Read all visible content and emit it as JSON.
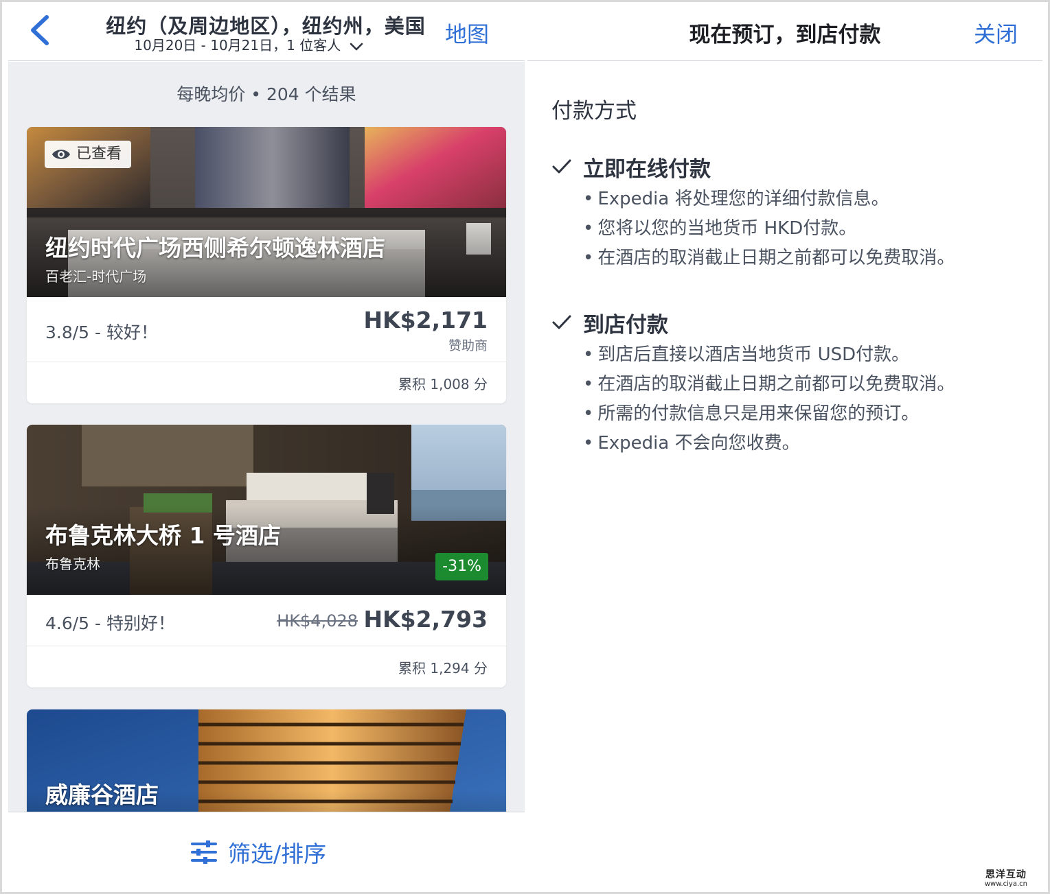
{
  "left": {
    "header": {
      "title": "纽约（及周边地区），纽约州，美国",
      "subtitle": "10月20日 - 10月21日，1 位客人",
      "map_label": "地图"
    },
    "summary": "每晚均价 • 204 个结果",
    "hotels": [
      {
        "name": "纽约时代广场西侧希尔顿逸林酒店",
        "area": "百老汇-时代广场",
        "viewed_label": "已查看",
        "rating": "3.8/5 - 较好！",
        "price": "HK$2,171",
        "sponsor": "赞助商",
        "points": "累积 1,008 分"
      },
      {
        "name": "布鲁克林大桥 1 号酒店",
        "area": "布鲁克林",
        "discount": "-31%",
        "rating": "4.6/5 - 特别好！",
        "old_price": "HK$4,028",
        "price": "HK$2,793",
        "points": "累积 1,294 分"
      },
      {
        "name": "威廉谷酒店"
      }
    ],
    "filter_label": "筛选/排序"
  },
  "right": {
    "title": "现在预订，到店付款",
    "close_label": "关闭",
    "section_title": "付款方式",
    "options": [
      {
        "title": "立即在线付款",
        "bullets": [
          "Expedia 将处理您的详细付款信息。",
          "您将以您的当地货币 HKD付款。",
          "在酒店的取消截止日期之前都可以免费取消。"
        ]
      },
      {
        "title": "到店付款",
        "bullets": [
          "到店后直接以酒店当地货币 USD付款。",
          "在酒店的取消截止日期之前都可以免费取消。",
          "所需的付款信息只是用来保留您的预订。",
          "Expedia 不会向您收费。"
        ]
      }
    ]
  },
  "watermark": {
    "name": "思洋互动",
    "url": "www.ciya.cn"
  },
  "colors": {
    "accent": "#2f6fd6",
    "discount": "#1c8a2e",
    "list_bg": "#eceef1"
  }
}
